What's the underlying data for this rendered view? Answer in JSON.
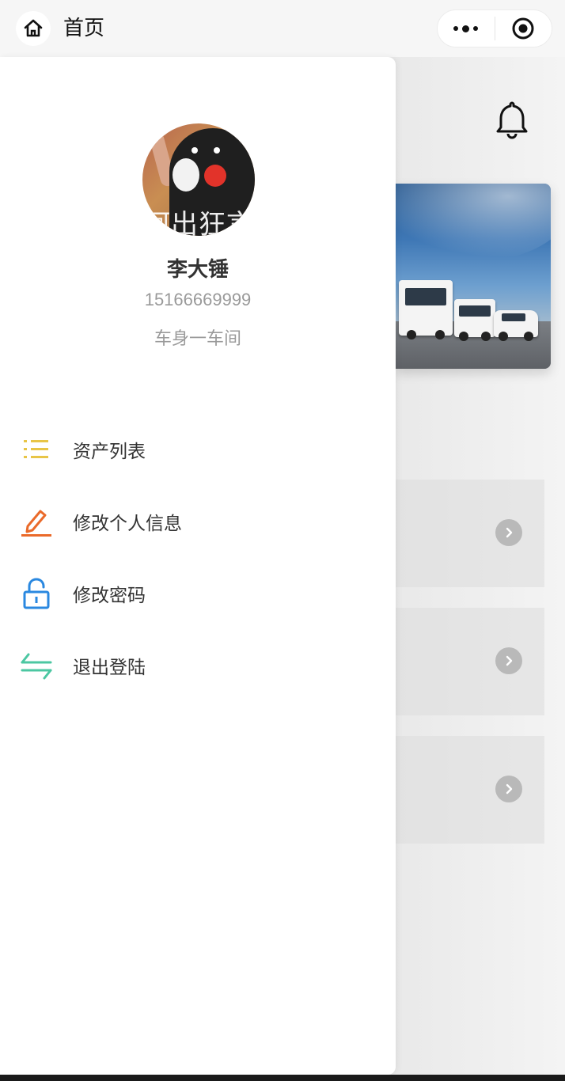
{
  "topbar": {
    "title": "首页",
    "home_icon": "home-icon",
    "more_icon": "more-dots-icon",
    "target_icon": "target-icon"
  },
  "drawer": {
    "avatar_caption": "呵出狂言",
    "user": {
      "name": "李大锤",
      "phone": "15166669999",
      "department": "车身一车间"
    },
    "menu": [
      {
        "label": "资产列表",
        "icon": "list-icon",
        "color": "#e8c547"
      },
      {
        "label": "修改个人信息",
        "icon": "pencil-icon",
        "color": "#ea6a2a"
      },
      {
        "label": "修改密码",
        "icon": "unlock-icon",
        "color": "#2a88e0"
      },
      {
        "label": "退出登陆",
        "icon": "switch-arrows-icon",
        "color": "#4cc7a2"
      }
    ]
  },
  "background_page": {
    "bell_icon": "bell-icon",
    "arrow_icon": "chevron-right-circle-icon"
  }
}
